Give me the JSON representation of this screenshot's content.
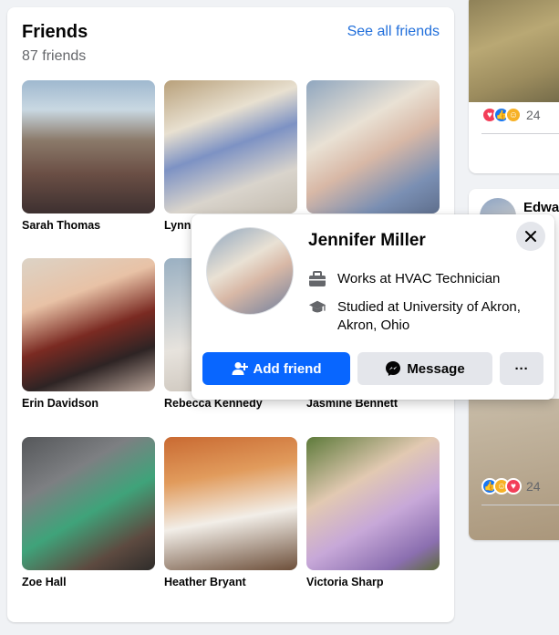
{
  "friends_card": {
    "title": "Friends",
    "count": "87 friends",
    "see_all": "See all friends",
    "friends": [
      {
        "name": "Sarah Thomas"
      },
      {
        "name": "Lynn"
      },
      {
        "name": ""
      },
      {
        "name": "Erin Davidson"
      },
      {
        "name": "Rebecca Kennedy"
      },
      {
        "name": "Jasmine Bennett"
      },
      {
        "name": "Zoe Hall"
      },
      {
        "name": "Heather Bryant"
      },
      {
        "name": "Victoria Sharp"
      }
    ]
  },
  "right_posts": {
    "post1": {
      "reaction_count": "24",
      "reactions": [
        "love-icon",
        "like-icon",
        "care-icon"
      ]
    },
    "post2": {
      "author": "Edwar",
      "reaction_count": "24",
      "reactions": [
        "like-icon",
        "care-icon",
        "love-icon"
      ]
    }
  },
  "hover_card": {
    "name": "Jennifer Miller",
    "work": "Works at HVAC Technician",
    "study": "Studied at University of Akron, Akron, Ohio",
    "add_friend": "Add friend",
    "message": "Message",
    "more": "···"
  },
  "colors": {
    "brand_blue": "#0866ff",
    "link_blue": "#216fdb",
    "secondary_button": "#e4e6eb",
    "page_bg": "#f0f2f5"
  }
}
